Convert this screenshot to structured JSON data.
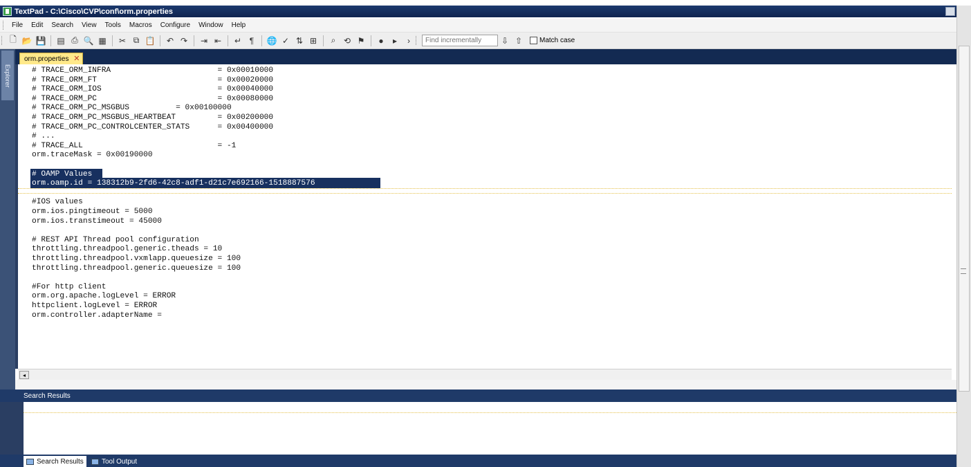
{
  "window": {
    "title": "TextPad - C:\\Cisco\\CVP\\conf\\orm.properties"
  },
  "menu": [
    "File",
    "Edit",
    "Search",
    "View",
    "Tools",
    "Macros",
    "Configure",
    "Window",
    "Help"
  ],
  "toolbar": {
    "icons": [
      "new-file-icon",
      "open-icon",
      "save-icon",
      "save-all-icon",
      "print-icon",
      "print-preview-icon",
      "properties-icon",
      "cut-icon",
      "copy-icon",
      "paste-icon",
      "undo-icon",
      "redo-icon",
      "indent-icon",
      "outdent-icon",
      "word-wrap-icon",
      "pilcrow-icon",
      "browser-icon",
      "spellcheck-icon",
      "sort-icon",
      "compare-icon",
      "find-icon",
      "replace-icon",
      "find-in-files-icon",
      "record-macro-icon",
      "play-macro-icon",
      "next-icon"
    ],
    "find_placeholder": "Find incrementally",
    "match_case_label": "Match case",
    "match_case_checked": false
  },
  "explorer": {
    "label": "Explorer"
  },
  "document": {
    "tab_label": "orm.properties",
    "close_glyph": "✕",
    "lines": [
      "# TRACE_ORM_INFRA                       = 0x00010000",
      "# TRACE_ORM_FT                          = 0x00020000",
      "# TRACE_ORM_IOS                         = 0x00040000",
      "# TRACE_ORM_PC                          = 0x00080000",
      "# TRACE_ORM_PC_MSGBUS          = 0x00100000",
      "# TRACE_ORM_PC_MSGBUS_HEARTBEAT         = 0x00200000",
      "# TRACE_ORM_PC_CONTROLCENTER_STATS      = 0x00400000",
      "# ...",
      "# TRACE_ALL                             = -1",
      "orm.traceMask = 0x00190000",
      "",
      "# OAMP Values",
      "orm.oamp.id = 138312b9-2fd6-42c8-adf1-d21c7e692166-1518887576",
      "",
      "#IOS values",
      "orm.ios.pingtimeout = 5000",
      "orm.ios.transtimeout = 45000",
      "",
      "# REST API Thread pool configuration",
      "throttling.threadpool.generic.theads = 10",
      "throttling.threadpool.vxmlapp.queuesize = 100",
      "throttling.threadpool.generic.queuesize = 100",
      "",
      "#For http client",
      "orm.org.apache.logLevel = ERROR",
      "httpclient.logLevel = ERROR",
      "orm.controller.adapterName ="
    ],
    "selected_lines": [
      11,
      12
    ]
  },
  "search_results": {
    "header": "Search Results"
  },
  "bottom_tabs": [
    {
      "label": "Search Results",
      "active": true
    },
    {
      "label": "Tool Output",
      "active": false
    }
  ]
}
